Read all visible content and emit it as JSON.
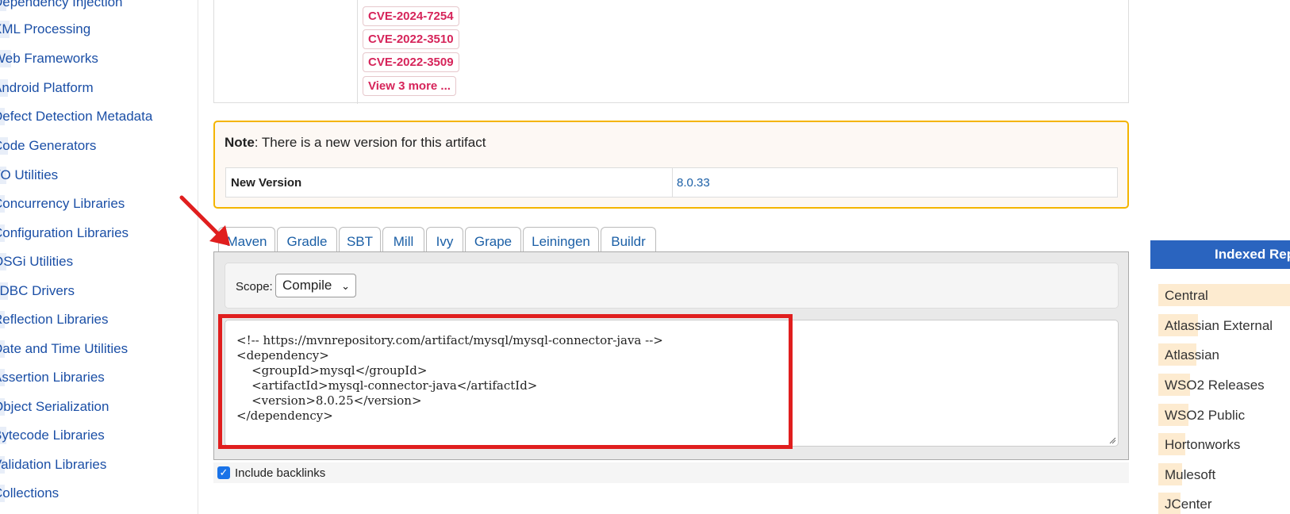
{
  "sidebar": {
    "categories": [
      "Dependency Injection",
      "XML Processing",
      "Web Frameworks",
      "Android Platform",
      "Defect Detection Metadata",
      "Code Generators",
      "I/O Utilities",
      "Concurrency Libraries",
      "Configuration Libraries",
      "OSGi Utilities",
      "JDBC Drivers",
      "Reflection Libraries",
      "Date and Time Utilities",
      "Assertion Libraries",
      "Object Serialization",
      "Bytecode Libraries",
      "Validation Libraries",
      "Collections"
    ]
  },
  "vulnerabilities": {
    "cves": [
      "CVE-2024-7254",
      "CVE-2022-3510",
      "CVE-2022-3509"
    ],
    "more_link": "View 3 more ..."
  },
  "note": {
    "label": "Note",
    "text": ": There is a new version for this artifact",
    "new_version_label": "New Version",
    "new_version_value": "8.0.33"
  },
  "tabs": [
    "Maven",
    "Gradle",
    "SBT",
    "Mill",
    "Ivy",
    "Grape",
    "Leiningen",
    "Buildr"
  ],
  "active_tab": "Maven",
  "scope": {
    "label": "Scope:",
    "selected": "Compile"
  },
  "snippet": "<!-- https://mvnrepository.com/artifact/mysql/mysql-connector-java -->\n<dependency>\n    <groupId>mysql</groupId>\n    <artifactId>mysql-connector-java</artifactId>\n    <version>8.0.25</version>\n</dependency>",
  "backlinks": {
    "label": "Include backlinks",
    "checked": true
  },
  "repositories": {
    "header": "Indexed Repositories",
    "items": [
      {
        "name": "Central"
      },
      {
        "name": "Atlassian External"
      },
      {
        "name": "Atlassian"
      },
      {
        "name": "WSO2 Releases"
      },
      {
        "name": "WSO2 Public"
      },
      {
        "name": "Hortonworks"
      },
      {
        "name": "Mulesoft"
      },
      {
        "name": "JCenter"
      }
    ]
  },
  "colors": {
    "link": "#1b4fa6",
    "cve": "#d6245a",
    "note_border": "#f4b400",
    "annotation": "#e01e1e",
    "repo_header": "#2a64bf",
    "repo_bar": "#fdebd0"
  },
  "icons": [
    "arrow-annotation-icon",
    "chevron-down-icon",
    "checkbox-checked-icon",
    "resize-handle-icon"
  ]
}
